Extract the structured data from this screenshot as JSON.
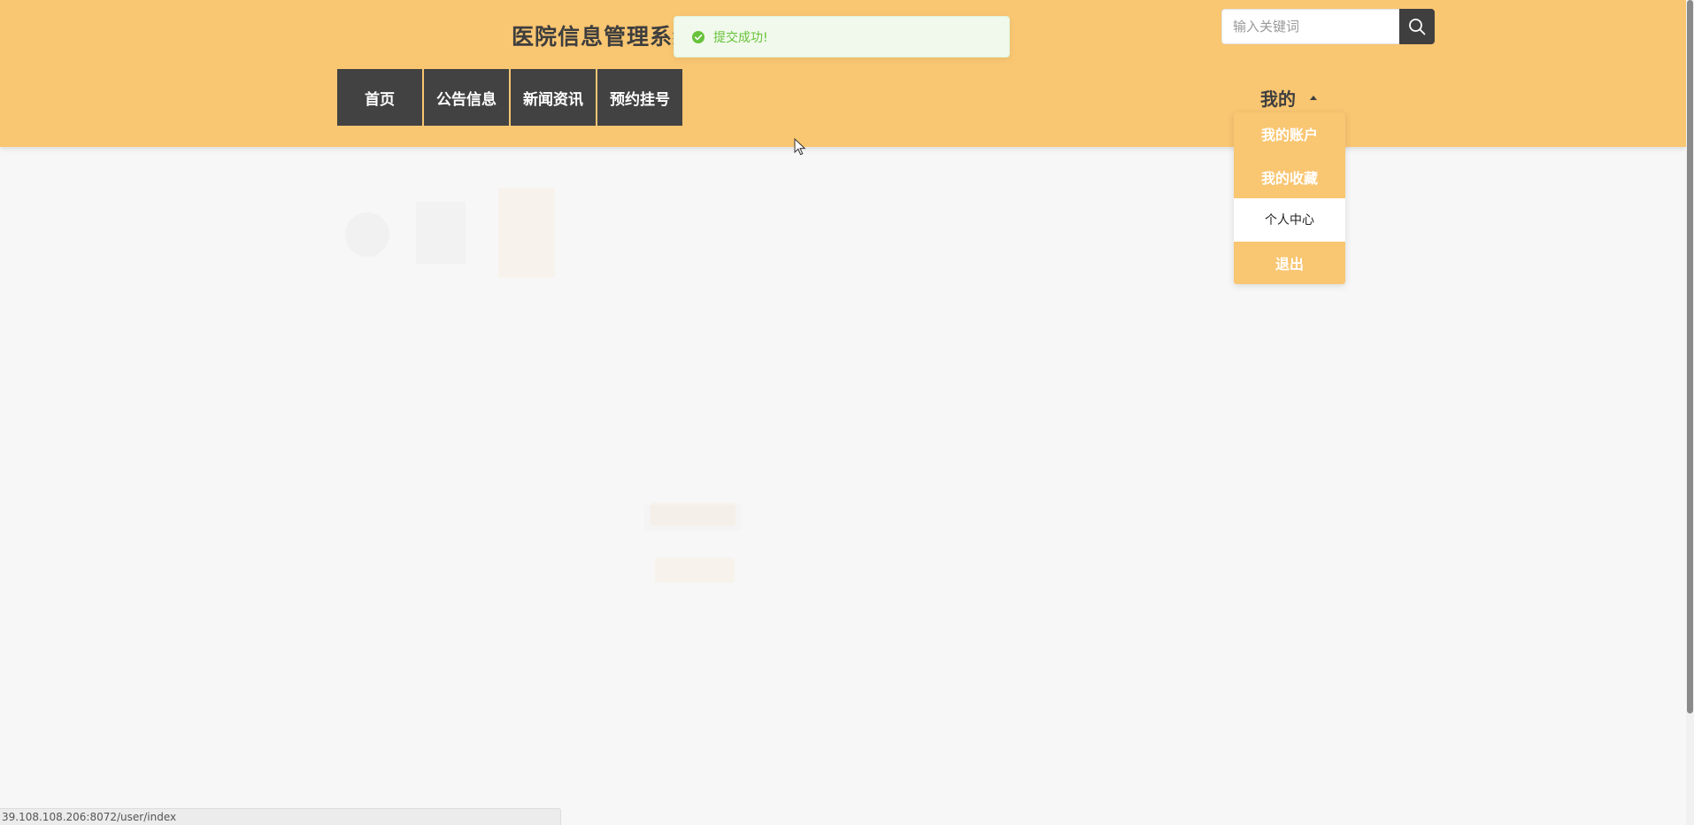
{
  "header": {
    "site_title": "医院信息管理系统",
    "nav_items": [
      "首页",
      "公告信息",
      "新闻资讯",
      "预约挂号"
    ],
    "search": {
      "placeholder": "输入关键词",
      "value": ""
    },
    "search_icon": "search-icon",
    "mine_label": "我的",
    "mine_caret_icon": "caret-up-icon"
  },
  "dropdown": {
    "items": [
      {
        "label": "我的账户",
        "active": false
      },
      {
        "label": "我的收藏",
        "active": false
      },
      {
        "label": "个人中心",
        "active": true
      },
      {
        "label": "退出",
        "active": false
      }
    ]
  },
  "toast": {
    "icon": "check-circle-icon",
    "message": "提交成功!"
  },
  "status_bar": {
    "url": "39.108.108.206:8072/user/index"
  },
  "colors": {
    "header_bg": "#f9c672",
    "nav_bg": "#424242",
    "toast_bg": "#f0f9eb",
    "toast_text": "#67c23a",
    "page_bg": "#f7f7f7"
  }
}
